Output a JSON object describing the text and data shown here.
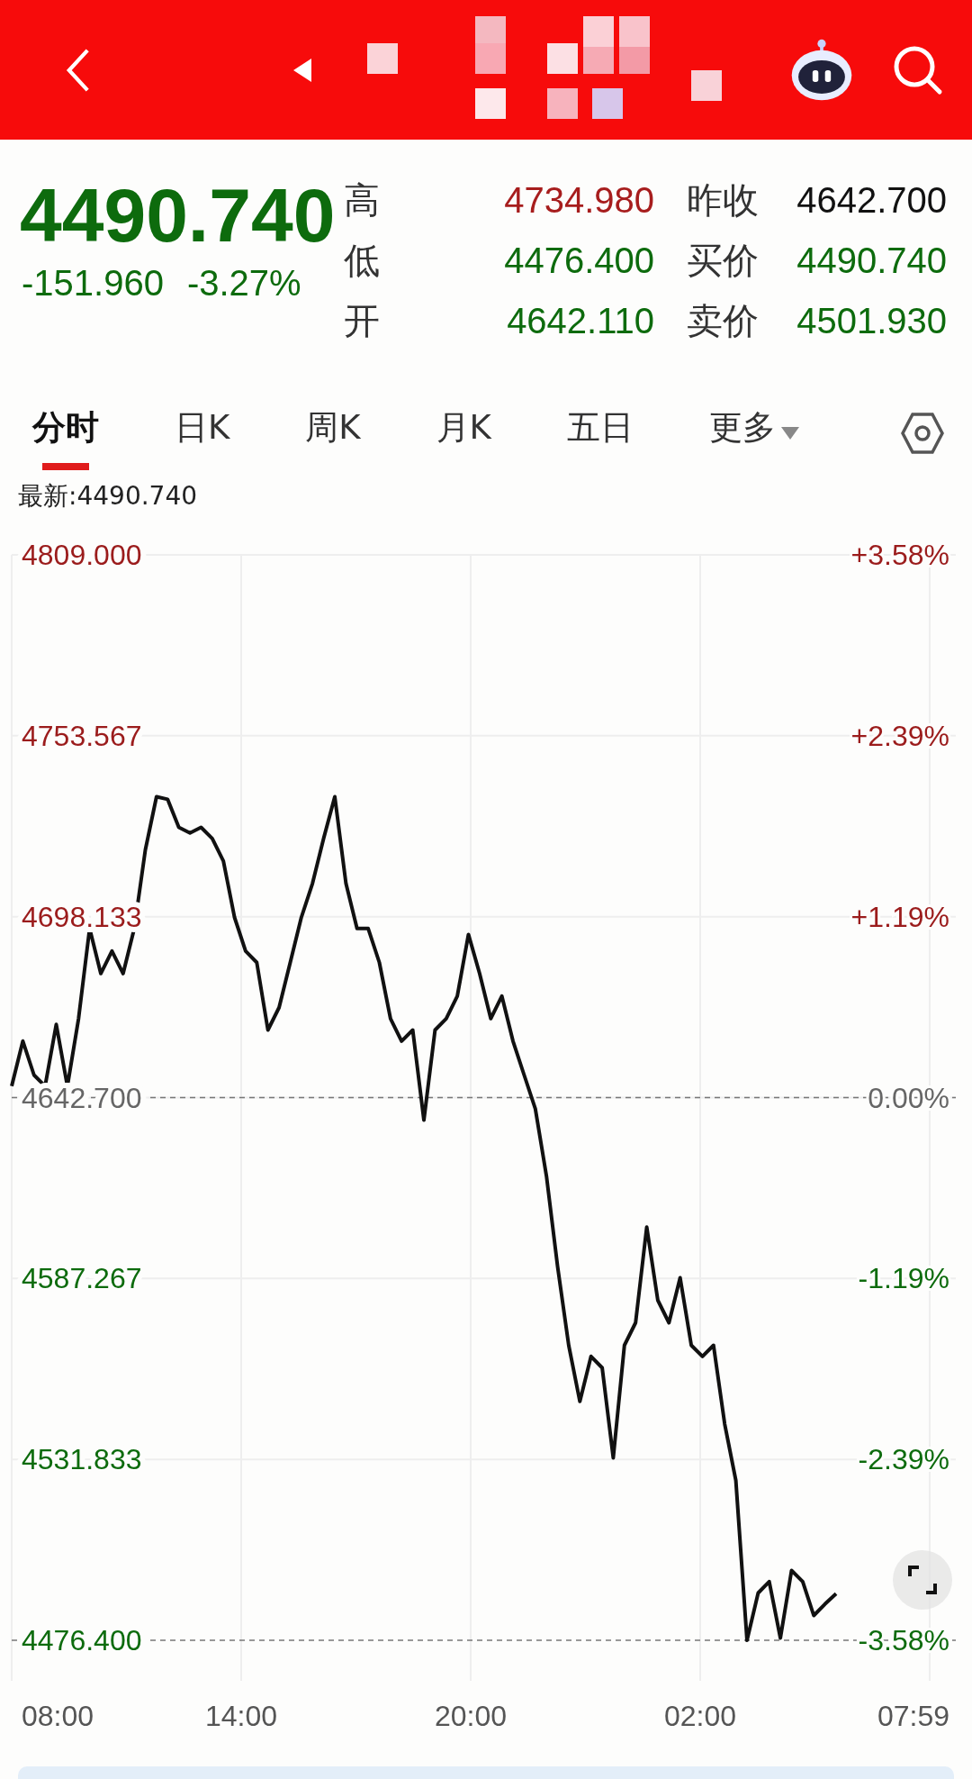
{
  "header": {
    "title_obscured": true
  },
  "quote": {
    "price": "4490.740",
    "change": "-151.960",
    "change_pct": "-3.27%",
    "color": "#0d6b0d",
    "stats": [
      {
        "label": "高",
        "value": "4734.980",
        "color": "#a71d1d"
      },
      {
        "label": "昨收",
        "value": "4642.700",
        "color": "#111111"
      },
      {
        "label": "低",
        "value": "4476.400",
        "color": "#0d6b0d"
      },
      {
        "label": "买价",
        "value": "4490.740",
        "color": "#0d6b0d"
      },
      {
        "label": "开",
        "value": "4642.110",
        "color": "#0d6b0d"
      },
      {
        "label": "卖价",
        "value": "4501.930",
        "color": "#0d6b0d"
      }
    ]
  },
  "tabs": [
    {
      "label": "分时",
      "selected": true
    },
    {
      "label": "日K",
      "selected": false
    },
    {
      "label": "周K",
      "selected": false
    },
    {
      "label": "月K",
      "selected": false
    },
    {
      "label": "五日",
      "selected": false
    }
  ],
  "more_menu": {
    "label": "更多"
  },
  "chart": {
    "latest": "最新:4490.740",
    "time_labels": [
      "08:00",
      "14:00",
      "20:00",
      "02:00",
      "07:59"
    ],
    "percent_labels": [
      {
        "text": "+3.58%",
        "color": "#9b1c1c"
      },
      {
        "text": "+2.39%",
        "color": "#9b1c1c"
      },
      {
        "text": "+1.19%",
        "color": "#9b1c1c"
      },
      {
        "text": "0.00%",
        "color": "#666666"
      },
      {
        "text": "-1.19%",
        "color": "#0d6b0d"
      },
      {
        "text": "-2.39%",
        "color": "#0d6b0d"
      },
      {
        "text": "-3.58%",
        "color": "#0d6b0d"
      }
    ],
    "chart_data": {
      "type": "line",
      "categories": [
        null,
        null,
        null,
        null,
        null,
        null,
        null,
        null,
        null,
        null,
        null,
        null,
        null,
        null,
        null,
        null,
        null,
        null,
        null,
        null,
        null,
        null,
        null,
        null,
        null,
        null,
        null,
        null,
        null,
        null,
        null,
        null,
        null,
        null,
        null,
        null,
        null,
        null,
        null,
        null,
        null,
        null,
        null,
        null,
        null,
        null,
        null,
        null,
        null,
        null,
        null,
        null,
        null,
        null,
        null,
        null,
        null,
        null,
        null,
        null,
        null,
        null,
        null,
        null,
        null,
        null,
        null,
        null,
        null,
        null,
        null,
        null,
        null,
        null,
        null
      ],
      "series": [
        {
          "color": "#111111",
          "values": [
            4646.2,
            4660.0,
            4649.6,
            4646.2,
            4665.1,
            4646.2,
            4666.9,
            4694.5,
            4680.7,
            4687.6,
            4680.7,
            4694.5,
            4718.6,
            4734.9,
            4734.1,
            4725.5,
            4723.8,
            4725.5,
            4722.1,
            4715.2,
            4697.9,
            4687.6,
            4684.1,
            4663.4,
            4670.3,
            4684.1,
            4697.9,
            4708.3,
            4722.1,
            4734.9,
            4708.3,
            4694.5,
            4694.5,
            4684.1,
            4666.9,
            4660.0,
            4663.4,
            4635.8,
            4663.4,
            4666.9,
            4673.8,
            4692.7,
            4680.7,
            4666.9,
            4673.8,
            4660.0,
            4649.6,
            4639.3,
            4618.6,
            4591.0,
            4566.8,
            4549.6,
            4563.4,
            4559.9,
            4532.3,
            4566.8,
            4573.7,
            4603.0,
            4580.6,
            4573.7,
            4587.5,
            4566.8,
            4563.4,
            4566.8,
            4542.7,
            4525.4,
            4476.4,
            4490.9,
            4494.4,
            4477.1,
            4497.8,
            4494.4,
            4484.0,
            4487.5,
            4490.7
          ]
        }
      ],
      "ylim": [
        4476.4,
        4809.0
      ],
      "grid": true,
      "ref_lines": [
        {
          "axis": "y",
          "value": 4642.7
        }
      ],
      "yticks": [
        {
          "value": 4809.0,
          "label": "4809.000"
        },
        {
          "value": 4753.567,
          "label": "4753.567"
        },
        {
          "value": 4698.133,
          "label": "4698.133"
        },
        {
          "value": 4642.7,
          "label": "4642.700"
        },
        {
          "value": 4587.267,
          "label": "4587.267"
        },
        {
          "value": 4531.833,
          "label": "4531.833"
        },
        {
          "value": 4476.4,
          "label": "4476.400"
        }
      ]
    }
  }
}
